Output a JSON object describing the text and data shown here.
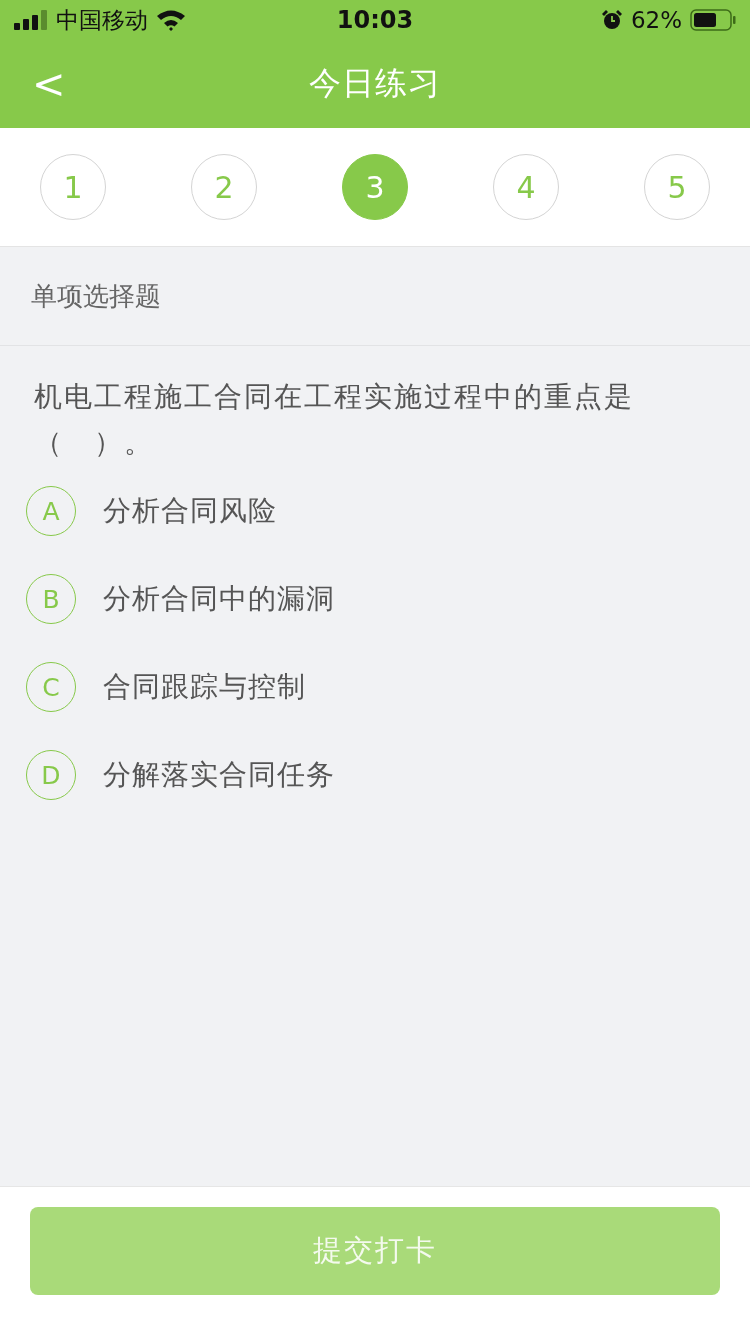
{
  "status_bar": {
    "carrier": "中国移动",
    "time": "10:03",
    "battery_percent": "62%"
  },
  "nav": {
    "back": "<",
    "title": "今日练习"
  },
  "steps": [
    {
      "label": "1",
      "selected": false
    },
    {
      "label": "2",
      "selected": false
    },
    {
      "label": "3",
      "selected": true
    },
    {
      "label": "4",
      "selected": false
    },
    {
      "label": "5",
      "selected": false
    }
  ],
  "question": {
    "type_label": "单项选择题",
    "text": "机电工程施工合同在工程实施过程中的重点是（　）。",
    "options": [
      {
        "letter": "A",
        "text": "分析合同风险",
        "selected": false
      },
      {
        "letter": "B",
        "text": "分析合同中的漏洞",
        "selected": false
      },
      {
        "letter": "C",
        "text": "合同跟踪与控制",
        "selected": false
      },
      {
        "letter": "D",
        "text": "分解落实合同任务",
        "selected": false
      }
    ]
  },
  "submit": {
    "label": "提交打卡",
    "disabled": true
  }
}
